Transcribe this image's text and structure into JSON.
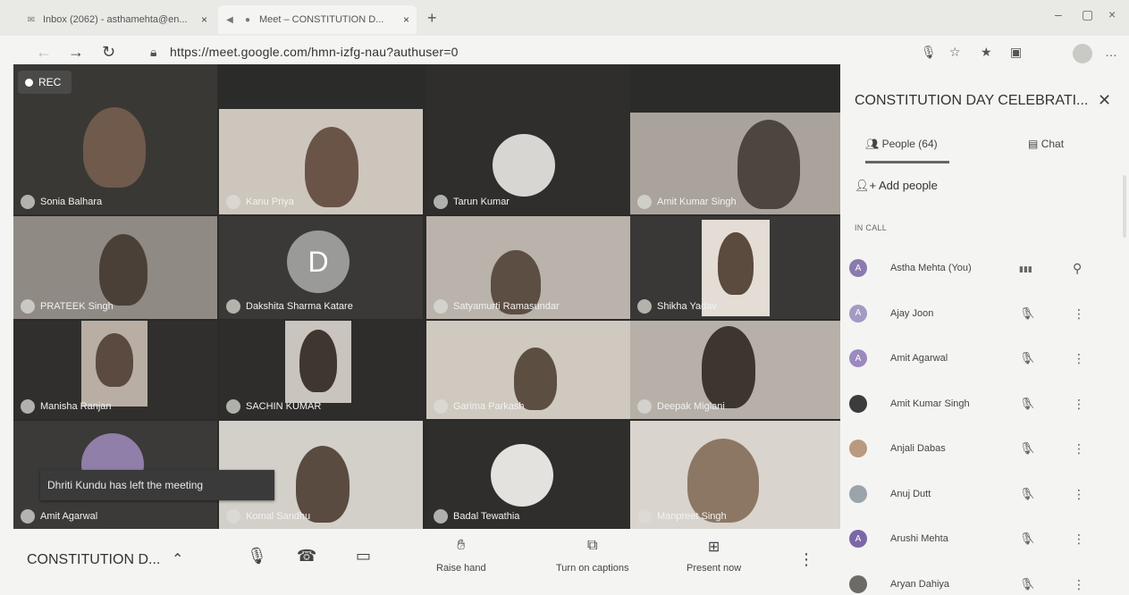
{
  "browser": {
    "tabs": [
      {
        "label": "Inbox (2062) - asthamehta@en...",
        "close": "×"
      },
      {
        "label": "Meet – CONSTITUTION D...",
        "close": "×"
      }
    ],
    "new_tab": "+",
    "url": "https://meet.google.com/hmn-izfg-nau?authuser=0"
  },
  "stage": {
    "rec_label": "REC",
    "toast": "Dhriti Kundu has left the meeting",
    "tiles": [
      {
        "name": "Sonia Balhara"
      },
      {
        "name": "Kanu Priya"
      },
      {
        "name": "Tarun Kumar"
      },
      {
        "name": "Amit Kumar Singh"
      },
      {
        "name": "PRATEEK Singh"
      },
      {
        "name": "Dakshita Sharma Katare",
        "initial": "D"
      },
      {
        "name": "Satyamurti Ramasundar"
      },
      {
        "name": "Shikha Yadav"
      },
      {
        "name": "Manisha Ranjan"
      },
      {
        "name": "SACHIN KUMAR"
      },
      {
        "name": "Garima Parkash"
      },
      {
        "name": "Deepak Miglani"
      },
      {
        "name": "Amit Agarwal"
      },
      {
        "name": "Komal Sandhu"
      },
      {
        "name": "Badal Tewathia"
      },
      {
        "name": "Manpreet Singh"
      }
    ]
  },
  "bottombar": {
    "meeting_title": "CONSTITUTION D...",
    "raise_hand": "Raise hand",
    "captions": "Turn on captions",
    "present": "Present now"
  },
  "panel": {
    "title": "CONSTITUTION DAY CELEBRATI...",
    "people_tab": "People (64)",
    "chat_tab": "Chat",
    "add_people": "Add people",
    "in_call": "IN CALL",
    "participants": [
      {
        "name": "Astha Mehta (You)",
        "initial": "A",
        "color": "#8a7ab0"
      },
      {
        "name": "Ajay Joon",
        "initial": "A",
        "color": "#a59ac4"
      },
      {
        "name": "Amit Agarwal",
        "initial": "A",
        "color": "#9c89c0"
      },
      {
        "name": "Amit Kumar Singh",
        "initial": "",
        "color": "#3c3c3c"
      },
      {
        "name": "Anjali Dabas",
        "initial": "",
        "color": "#b99a7f"
      },
      {
        "name": "Anuj Dutt",
        "initial": "",
        "color": "#9aa4aa"
      },
      {
        "name": "Arushi Mehta",
        "initial": "A",
        "color": "#7b67a8"
      },
      {
        "name": "Aryan Dahiya",
        "initial": "",
        "color": "#6e6a66"
      }
    ]
  },
  "colors": {
    "accent": "#8a7ab0",
    "stage": "#2b2b2a"
  }
}
